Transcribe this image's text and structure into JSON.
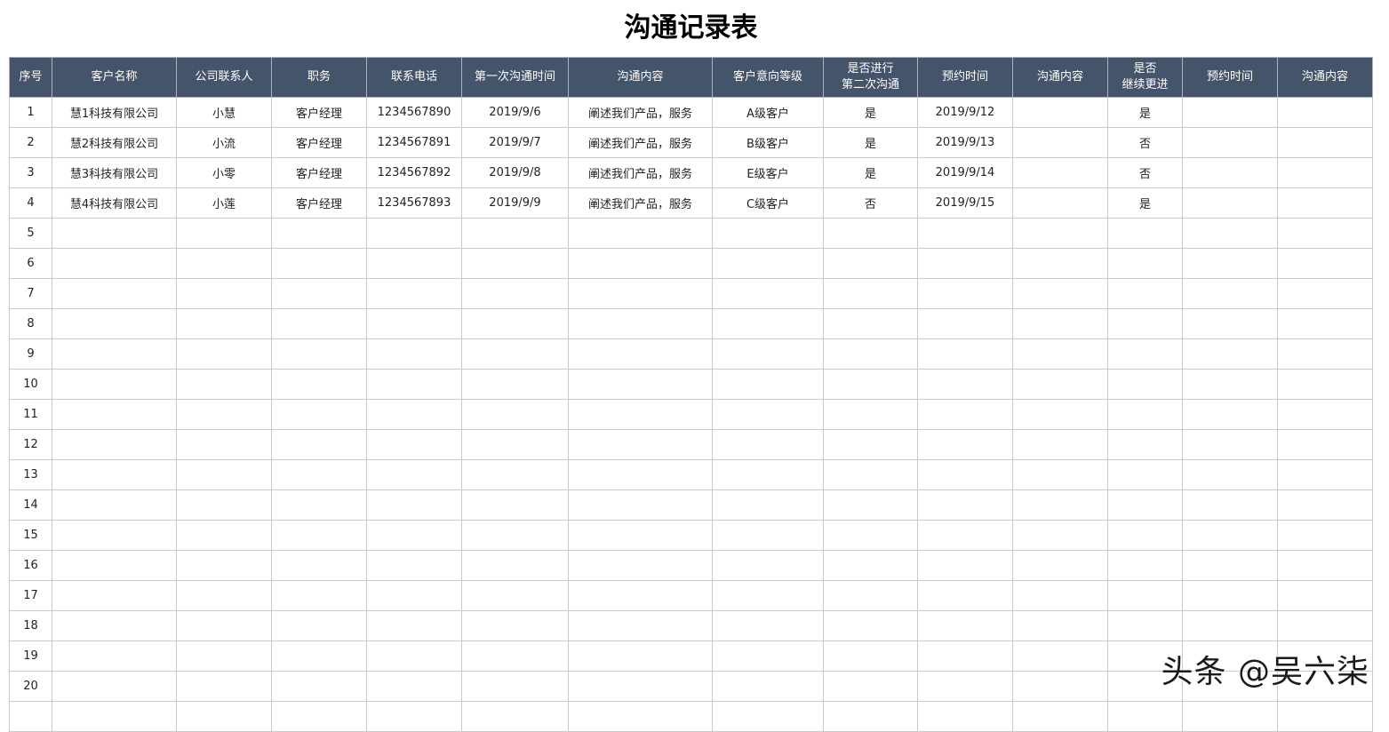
{
  "title": "沟通记录表",
  "headers": [
    "序号",
    "客户名称",
    "公司联系人",
    "职务",
    "联系电话",
    "第一次沟通时间",
    "沟通内容",
    "客户意向等级",
    "是否进行\n第二次沟通",
    "预约时间",
    "沟通内容",
    "是否\n继续更进",
    "预约时间",
    "沟通内容"
  ],
  "rows": [
    [
      "1",
      "慧1科技有限公司",
      "小慧",
      "客户经理",
      "1234567890",
      "2019/9/6",
      "阐述我们产品，服务",
      "A级客户",
      "是",
      "2019/9/12",
      "",
      "是",
      "",
      ""
    ],
    [
      "2",
      "慧2科技有限公司",
      "小流",
      "客户经理",
      "1234567891",
      "2019/9/7",
      "阐述我们产品，服务",
      "B级客户",
      "是",
      "2019/9/13",
      "",
      "否",
      "",
      ""
    ],
    [
      "3",
      "慧3科技有限公司",
      "小零",
      "客户经理",
      "1234567892",
      "2019/9/8",
      "阐述我们产品，服务",
      "E级客户",
      "是",
      "2019/9/14",
      "",
      "否",
      "",
      ""
    ],
    [
      "4",
      "慧4科技有限公司",
      "小莲",
      "客户经理",
      "1234567893",
      "2019/9/9",
      "阐述我们产品，服务",
      "C级客户",
      "否",
      "2019/9/15",
      "",
      "是",
      "",
      ""
    ],
    [
      "5",
      "",
      "",
      "",
      "",
      "",
      "",
      "",
      "",
      "",
      "",
      "",
      "",
      ""
    ],
    [
      "6",
      "",
      "",
      "",
      "",
      "",
      "",
      "",
      "",
      "",
      "",
      "",
      "",
      ""
    ],
    [
      "7",
      "",
      "",
      "",
      "",
      "",
      "",
      "",
      "",
      "",
      "",
      "",
      "",
      ""
    ],
    [
      "8",
      "",
      "",
      "",
      "",
      "",
      "",
      "",
      "",
      "",
      "",
      "",
      "",
      ""
    ],
    [
      "9",
      "",
      "",
      "",
      "",
      "",
      "",
      "",
      "",
      "",
      "",
      "",
      "",
      ""
    ],
    [
      "10",
      "",
      "",
      "",
      "",
      "",
      "",
      "",
      "",
      "",
      "",
      "",
      "",
      ""
    ],
    [
      "11",
      "",
      "",
      "",
      "",
      "",
      "",
      "",
      "",
      "",
      "",
      "",
      "",
      ""
    ],
    [
      "12",
      "",
      "",
      "",
      "",
      "",
      "",
      "",
      "",
      "",
      "",
      "",
      "",
      ""
    ],
    [
      "13",
      "",
      "",
      "",
      "",
      "",
      "",
      "",
      "",
      "",
      "",
      "",
      "",
      ""
    ],
    [
      "14",
      "",
      "",
      "",
      "",
      "",
      "",
      "",
      "",
      "",
      "",
      "",
      "",
      ""
    ],
    [
      "15",
      "",
      "",
      "",
      "",
      "",
      "",
      "",
      "",
      "",
      "",
      "",
      "",
      ""
    ],
    [
      "16",
      "",
      "",
      "",
      "",
      "",
      "",
      "",
      "",
      "",
      "",
      "",
      "",
      ""
    ],
    [
      "17",
      "",
      "",
      "",
      "",
      "",
      "",
      "",
      "",
      "",
      "",
      "",
      "",
      ""
    ],
    [
      "18",
      "",
      "",
      "",
      "",
      "",
      "",
      "",
      "",
      "",
      "",
      "",
      "",
      ""
    ],
    [
      "19",
      "",
      "",
      "",
      "",
      "",
      "",
      "",
      "",
      "",
      "",
      "",
      "",
      ""
    ],
    [
      "20",
      "",
      "",
      "",
      "",
      "",
      "",
      "",
      "",
      "",
      "",
      "",
      "",
      ""
    ],
    [
      "",
      "",
      "",
      "",
      "",
      "",
      "",
      "",
      "",
      "",
      "",
      "",
      "",
      ""
    ]
  ],
  "watermark": "头条 @吴六柒",
  "colors": {
    "header_bg": "#44546a",
    "header_text": "#ffffff",
    "grid": "#c8cacd"
  }
}
